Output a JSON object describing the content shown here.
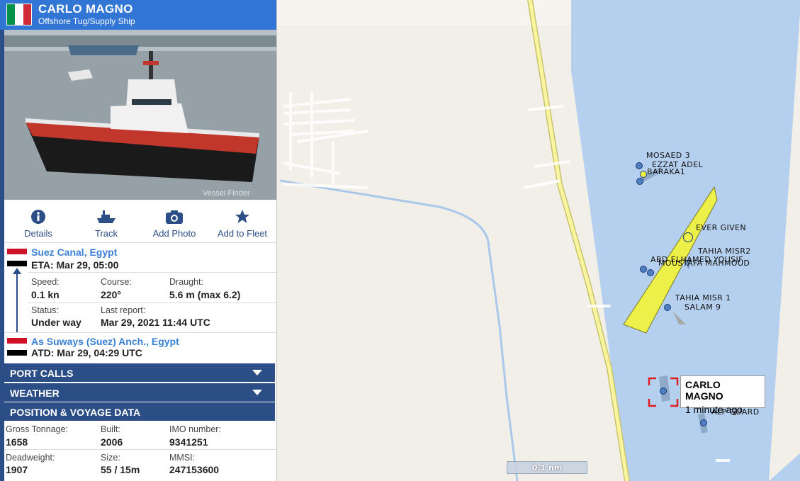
{
  "vessel": {
    "name": "CARLO MAGNO",
    "type": "Offshore Tug/Supply Ship",
    "flag_colors": [
      "#009246",
      "#ffffff",
      "#ce2b37"
    ],
    "photo_watermark": "Vessel Finder"
  },
  "actions": [
    {
      "label": "Details",
      "icon": "info-icon"
    },
    {
      "label": "Track",
      "icon": "ship-icon"
    },
    {
      "label": "Add Photo",
      "icon": "camera-icon"
    },
    {
      "label": "Add to Fleet",
      "icon": "star-icon"
    }
  ],
  "voyage": {
    "destination": "Suez Canal, Egypt",
    "eta": "ETA: Mar 29, 05:00",
    "origin": "As Suways (Suez) Anch., Egypt",
    "atd": "ATD: Mar 29, 04:29 UTC",
    "flag_colors": [
      "#ce1126",
      "#ffffff",
      "#000000"
    ]
  },
  "status": {
    "speed_label": "Speed:",
    "speed": "0.1 kn",
    "course_label": "Course:",
    "course": "220°",
    "draught_label": "Draught:",
    "draught": "5.6 m (max 6.2)",
    "status_label": "Status:",
    "status": "Under way",
    "report_label": "Last report:",
    "report": "Mar 29, 2021 11:44 UTC"
  },
  "sections": {
    "port_calls": "PORT CALLS",
    "weather": "WEATHER",
    "position": "POSITION & VOYAGE DATA"
  },
  "details": {
    "gross_tonnage_label": "Gross Tonnage:",
    "gross_tonnage": "1658",
    "built_label": "Built:",
    "built": "2006",
    "imo_label": "IMO number:",
    "imo": "9341251",
    "deadweight_label": "Deadweight:",
    "deadweight": "1907",
    "size_label": "Size:",
    "size": "55 / 15m",
    "mmsi_label": "MMSI:",
    "mmsi": "247153600"
  },
  "map": {
    "vessel_labels": {
      "mosaed": "MOSAED 3",
      "ezzat": "EZZAT ADEL",
      "baraka": "BARAKA1",
      "ever_given": "EVER GIVEN",
      "tahia2": "TAHIA MISR2",
      "abd": "ABD ELHAMED YOUSIF",
      "moustafa": "MOUSTAFA MAHMOUD",
      "tahia1": "TAHIA MISR 1",
      "salam": "SALAM 9",
      "alp": "ALP GUARD"
    },
    "tooltip_name": "CARLO MAGNO",
    "tooltip_time": "1 minute ago",
    "scale": "0.1 nm",
    "colors": {
      "land": "#f2efe9",
      "water": "#b5d0ef",
      "road": "#f8f4a0",
      "ever_given": "#eef04a",
      "selected": "#e02020"
    }
  }
}
